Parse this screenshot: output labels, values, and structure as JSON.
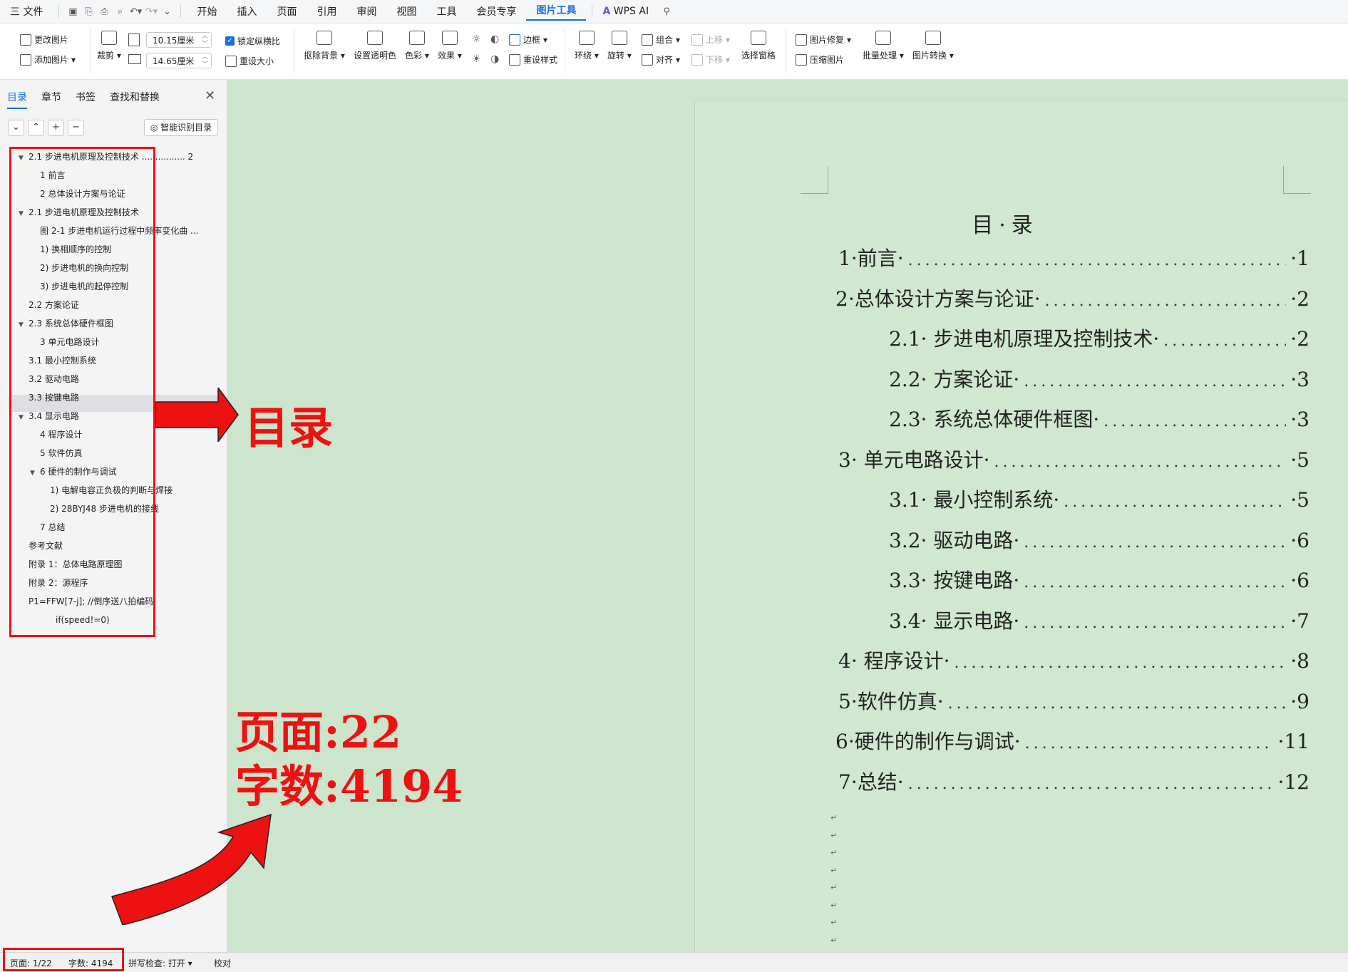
{
  "menubar": {
    "file": "三 文件",
    "tabs": [
      "开始",
      "插入",
      "页面",
      "引用",
      "审阅",
      "视图",
      "工具",
      "会员专享",
      "图片工具"
    ],
    "active_tab": "图片工具",
    "wps_ai": "WPS AI"
  },
  "ribbon": {
    "change_image": "更改图片",
    "add_image": "添加图片",
    "crop": "裁剪",
    "width_value": "10.15厘米",
    "height_value": "14.65厘米",
    "lock_ratio": "锁定纵横比",
    "reset_size": "重设大小",
    "remove_bg": "抠除背景",
    "set_transparent": "设置透明色",
    "color": "色彩",
    "effects": "效果",
    "border": "边框",
    "reset_style": "重设样式",
    "wrap": "环绕",
    "rotate": "旋转",
    "group": "组合",
    "align": "对齐",
    "move_up": "上移",
    "move_down": "下移",
    "selection_pane": "选择窗格",
    "image_repair": "图片修复",
    "compress": "压缩图片",
    "batch": "批量处理",
    "convert": "图片转换"
  },
  "nav": {
    "tabs": [
      "目录",
      "章节",
      "书签",
      "查找和替换"
    ],
    "smart_btn": "智能识别目录",
    "items": [
      {
        "text": "2.1  步进电机原理及控制技术  ................ 2",
        "tw": "▼",
        "indent": 0
      },
      {
        "text": "1  前言",
        "tw": "",
        "indent": 1
      },
      {
        "text": "2   总体设计方案与论证",
        "tw": "",
        "indent": 1
      },
      {
        "text": "2.1  步进电机原理及控制技术",
        "tw": "▼",
        "indent": 0
      },
      {
        "text": "图  2-1     步进电机运行过程中频率变化曲 ...",
        "tw": "",
        "indent": 1
      },
      {
        "text": "1)    换相顺序的控制",
        "tw": "",
        "indent": 1
      },
      {
        "text": "2)    步进电机的换向控制",
        "tw": "",
        "indent": 1
      },
      {
        "text": "3)  步进电机的起停控制",
        "tw": "",
        "indent": 1
      },
      {
        "text": "2.2    方案论证",
        "tw": "",
        "indent": 0
      },
      {
        "text": "2.3  系统总体硬件框图",
        "tw": "▼",
        "indent": 0
      },
      {
        "text": "3    单元电路设计",
        "tw": "",
        "indent": 1
      },
      {
        "text": "3.1  最小控制系统",
        "tw": "",
        "indent": 0
      },
      {
        "text": "3.2    驱动电路",
        "tw": "",
        "indent": 0
      },
      {
        "text": "3.3  按键电路",
        "tw": "",
        "indent": 0
      },
      {
        "text": "3.4  显示电路",
        "tw": "▼",
        "indent": 0
      },
      {
        "text": "4  程序设计",
        "tw": "",
        "indent": 1
      },
      {
        "text": "5  软件仿真",
        "tw": "",
        "indent": 1
      },
      {
        "text": "6  硬件的制作与调试",
        "tw": "▼",
        "indent": 1
      },
      {
        "text": "1)     电解电容正负极的判断与焊接",
        "tw": "",
        "indent": 2
      },
      {
        "text": "2)     28BYJ48  步进电机的接线",
        "tw": "",
        "indent": 2
      },
      {
        "text": "7  总结",
        "tw": "",
        "indent": 1
      },
      {
        "text": "参考文献",
        "tw": "",
        "indent": 0
      },
      {
        "text": "附录    1：总体电路原理图",
        "tw": "",
        "indent": 0
      },
      {
        "text": "附录  2：源程序",
        "tw": "",
        "indent": 0
      },
      {
        "text": "P1=FFW[7-j];      //倒序送八拍编码",
        "tw": "",
        "indent": 0
      },
      {
        "text": "if(speed!=0)",
        "tw": "",
        "indent": 3
      }
    ]
  },
  "document": {
    "title": "目·录",
    "toc": [
      {
        "label": "1·前言·",
        "page": "·1"
      },
      {
        "label": "2·总体设计方案与论证·",
        "page": "·2"
      },
      {
        "label": "2.1· 步进电机原理及控制技术·",
        "page": "·2"
      },
      {
        "label": "2.2· 方案论证·",
        "page": "·3"
      },
      {
        "label": "2.3· 系统总体硬件框图·",
        "page": "·3"
      },
      {
        "label": "3·  单元电路设计·",
        "page": "·5"
      },
      {
        "label": "3.1· 最小控制系统·",
        "page": "·5"
      },
      {
        "label": "3.2· 驱动电路·",
        "page": "·6"
      },
      {
        "label": "3.3· 按键电路·",
        "page": "·6"
      },
      {
        "label": "3.4· 显示电路·",
        "page": "·7"
      },
      {
        "label": "4·  程序设计·",
        "page": "·8"
      },
      {
        "label": "5·软件仿真·",
        "page": "·9"
      },
      {
        "label": "6·硬件的制作与调试·",
        "page": "·11"
      },
      {
        "label": "7·总结·",
        "page": "·12"
      }
    ]
  },
  "annotations": {
    "mulu": "目录",
    "pages": "页面:22",
    "words": "字数:4194"
  },
  "status": {
    "page": "页面: 1/22",
    "words": "字数: 4194",
    "spell": "拼写检查: 打开 ▾",
    "proof": "校对"
  },
  "colors": {
    "accent": "#1a6fd9",
    "annotation": "#ee1111",
    "page_bg": "#cfe8cf"
  }
}
